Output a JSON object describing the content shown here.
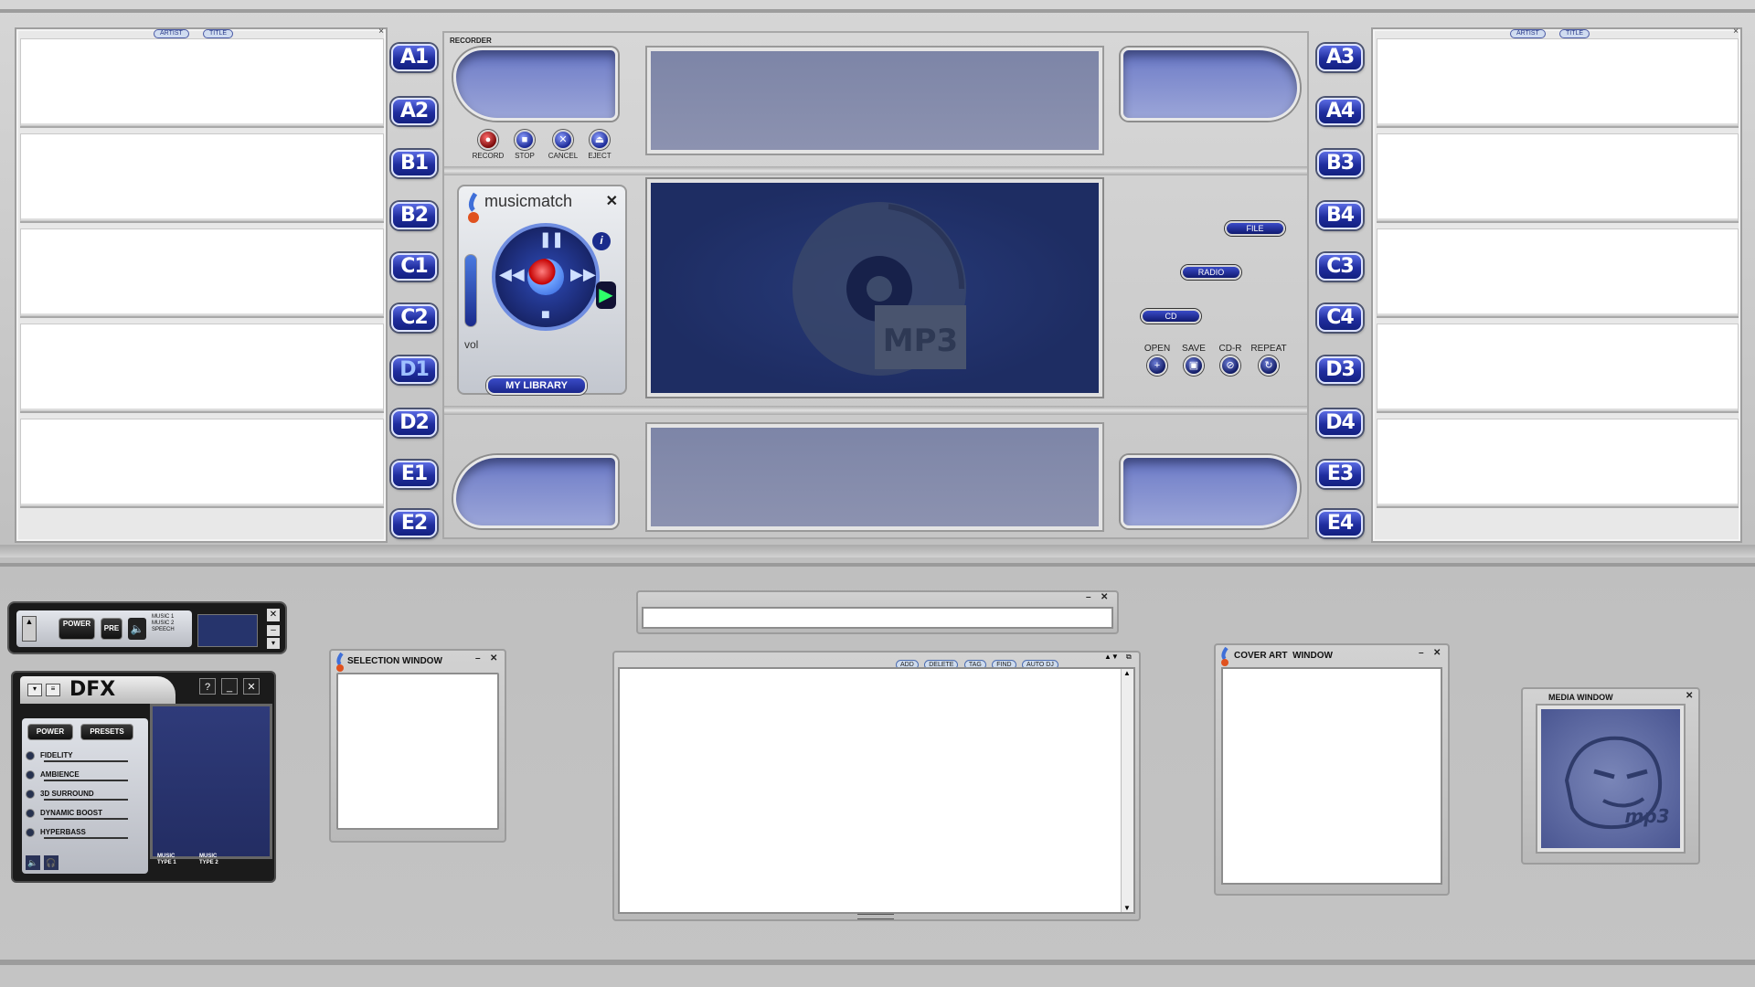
{
  "side_list_left": {
    "tabs": [
      "ARTIST",
      "TITLE"
    ],
    "close": "×"
  },
  "side_list_right": {
    "tabs": [
      "ARTIST",
      "TITLE"
    ],
    "close": "×"
  },
  "slots_left": [
    "A1",
    "A2",
    "B1",
    "B2",
    "C1",
    "C2",
    "D1",
    "D2",
    "E1",
    "E2"
  ],
  "slots_right": [
    "A3",
    "A4",
    "B3",
    "B4",
    "C3",
    "C4",
    "D3",
    "D4",
    "E3",
    "E4"
  ],
  "active_slot": "D1",
  "recorder": {
    "title": "RECORDER",
    "controls": [
      {
        "label": "RECORD",
        "icon": "record-icon"
      },
      {
        "label": "STOP",
        "icon": "stop-icon"
      },
      {
        "label": "CANCEL",
        "icon": "cancel-icon"
      },
      {
        "label": "EJECT",
        "icon": "eject-icon"
      }
    ]
  },
  "player": {
    "brand": "musicmatch",
    "close": "✕",
    "vol_label": "vol",
    "library_button": "MY LIBRARY"
  },
  "display": {
    "logo_text": "MP3"
  },
  "sources": {
    "file": "FILE",
    "radio": "RADIO",
    "cd": "CD"
  },
  "actions": [
    {
      "label": "OPEN",
      "glyph": "+"
    },
    {
      "label": "SAVE",
      "glyph": "▣"
    },
    {
      "label": "CD-R",
      "glyph": "⊘"
    },
    {
      "label": "REPEAT",
      "glyph": "↻"
    }
  ],
  "mini_bar": {
    "power": "POWER",
    "pre": "PRE",
    "modes": [
      "MUSIC 1",
      "MUSIC 2",
      "SPEECH"
    ]
  },
  "dfx": {
    "title": "DFX",
    "power": "POWER",
    "presets": "PRESETS",
    "rows": [
      {
        "label": "FIDELITY",
        "level": 0.35
      },
      {
        "label": "AMBIENCE",
        "level": 0.35
      },
      {
        "label": "3D SURROUND",
        "level": 0.35
      },
      {
        "label": "DYNAMIC BOOST",
        "level": 0.35
      },
      {
        "label": "HYPERBASS",
        "level": 0.35
      }
    ],
    "bottom": [
      "MUSIC TYPE 1",
      "MUSIC TYPE 2"
    ]
  },
  "selection_window": {
    "title": "SELECTION WINDOW"
  },
  "playlist": {
    "buttons": [
      "ADD",
      "DELETE",
      "TAG",
      "FIND",
      "AUTO DJ"
    ]
  },
  "cover_art": {
    "title": "COVER ART  WINDOW"
  },
  "media_window": {
    "title": "MEDIA WINDOW",
    "logo": "mp3"
  }
}
